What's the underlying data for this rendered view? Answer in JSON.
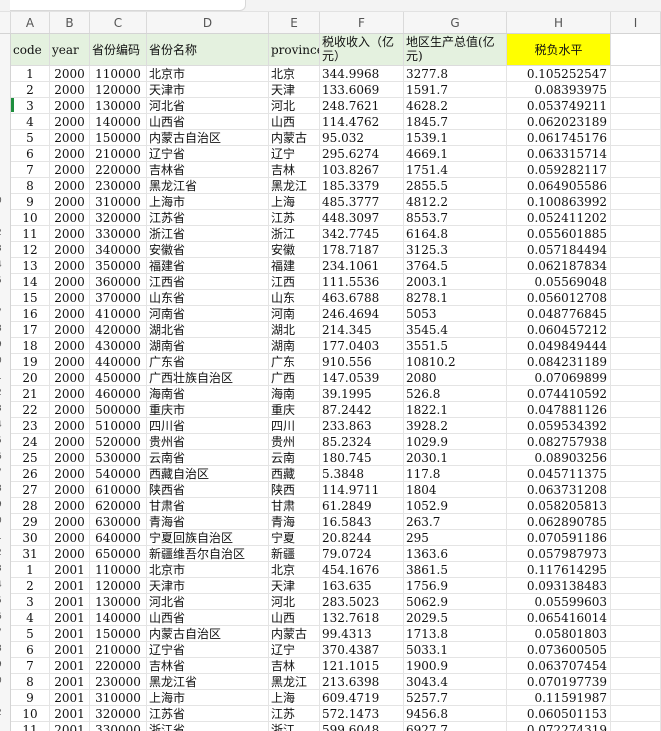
{
  "columns": [
    "A",
    "B",
    "C",
    "D",
    "E",
    "F",
    "G",
    "H",
    "I"
  ],
  "header": [
    "code",
    "year",
    "省份编码",
    "省份名称",
    "province",
    "税收收入（亿元）",
    "地区生产总值(亿元)",
    "税负水平",
    ""
  ],
  "left_row_markers": [
    "",
    "",
    "",
    "",
    "",
    "",
    "",
    "",
    "",
    "0",
    "",
    "2",
    "3",
    "4",
    "5",
    "",
    "7",
    "8",
    "9",
    "0",
    "1",
    "2",
    "3",
    "4",
    "5",
    "6",
    "7",
    "8",
    "9",
    "0",
    "1",
    "2",
    "3",
    "4",
    "5",
    "6",
    "7",
    "8",
    "9",
    "0",
    "",
    "2",
    "",
    ""
  ],
  "rows": [
    [
      "1",
      "2000",
      "110000",
      "北京市",
      "北京",
      "344.9968",
      "3277.8",
      "0.105252547"
    ],
    [
      "2",
      "2000",
      "120000",
      "天津市",
      "天津",
      "133.6069",
      "1591.7",
      "0.08393975"
    ],
    [
      "3",
      "2000",
      "130000",
      "河北省",
      "河北",
      "248.7621",
      "4628.2",
      "0.053749211"
    ],
    [
      "4",
      "2000",
      "140000",
      "山西省",
      "山西",
      "114.4762",
      "1845.7",
      "0.062023189"
    ],
    [
      "5",
      "2000",
      "150000",
      "内蒙古自治区",
      "内蒙古",
      "95.032",
      "1539.1",
      "0.061745176"
    ],
    [
      "6",
      "2000",
      "210000",
      "辽宁省",
      "辽宁",
      "295.6274",
      "4669.1",
      "0.063315714"
    ],
    [
      "7",
      "2000",
      "220000",
      "吉林省",
      "吉林",
      "103.8267",
      "1751.4",
      "0.059282117"
    ],
    [
      "8",
      "2000",
      "230000",
      "黑龙江省",
      "黑龙江",
      "185.3379",
      "2855.5",
      "0.064905586"
    ],
    [
      "9",
      "2000",
      "310000",
      "上海市",
      "上海",
      "485.3777",
      "4812.2",
      "0.100863992"
    ],
    [
      "10",
      "2000",
      "320000",
      "江苏省",
      "江苏",
      "448.3097",
      "8553.7",
      "0.052411202"
    ],
    [
      "11",
      "2000",
      "330000",
      "浙江省",
      "浙江",
      "342.7745",
      "6164.8",
      "0.055601885"
    ],
    [
      "12",
      "2000",
      "340000",
      "安徽省",
      "安徽",
      "178.7187",
      "3125.3",
      "0.057184494"
    ],
    [
      "13",
      "2000",
      "350000",
      "福建省",
      "福建",
      "234.1061",
      "3764.5",
      "0.062187834"
    ],
    [
      "14",
      "2000",
      "360000",
      "江西省",
      "江西",
      "111.5536",
      "2003.1",
      "0.05569048"
    ],
    [
      "15",
      "2000",
      "370000",
      "山东省",
      "山东",
      "463.6788",
      "8278.1",
      "0.056012708"
    ],
    [
      "16",
      "2000",
      "410000",
      "河南省",
      "河南",
      "246.4694",
      "5053",
      "0.048776845"
    ],
    [
      "17",
      "2000",
      "420000",
      "湖北省",
      "湖北",
      "214.345",
      "3545.4",
      "0.060457212"
    ],
    [
      "18",
      "2000",
      "430000",
      "湖南省",
      "湖南",
      "177.0403",
      "3551.5",
      "0.049849444"
    ],
    [
      "19",
      "2000",
      "440000",
      "广东省",
      "广东",
      "910.556",
      "10810.2",
      "0.084231189"
    ],
    [
      "20",
      "2000",
      "450000",
      "广西壮族自治区",
      "广西",
      "147.0539",
      "2080",
      "0.07069899"
    ],
    [
      "21",
      "2000",
      "460000",
      "海南省",
      "海南",
      "39.1995",
      "526.8",
      "0.074410592"
    ],
    [
      "22",
      "2000",
      "500000",
      "重庆市",
      "重庆",
      "87.2442",
      "1822.1",
      "0.047881126"
    ],
    [
      "23",
      "2000",
      "510000",
      "四川省",
      "四川",
      "233.863",
      "3928.2",
      "0.059534392"
    ],
    [
      "24",
      "2000",
      "520000",
      "贵州省",
      "贵州",
      "85.2324",
      "1029.9",
      "0.082757938"
    ],
    [
      "25",
      "2000",
      "530000",
      "云南省",
      "云南",
      "180.745",
      "2030.1",
      "0.08903256"
    ],
    [
      "26",
      "2000",
      "540000",
      "西藏自治区",
      "西藏",
      "5.3848",
      "117.8",
      "0.045711375"
    ],
    [
      "27",
      "2000",
      "610000",
      "陕西省",
      "陕西",
      "114.9711",
      "1804",
      "0.063731208"
    ],
    [
      "28",
      "2000",
      "620000",
      "甘肃省",
      "甘肃",
      "61.2849",
      "1052.9",
      "0.058205813"
    ],
    [
      "29",
      "2000",
      "630000",
      "青海省",
      "青海",
      "16.5843",
      "263.7",
      "0.062890785"
    ],
    [
      "30",
      "2000",
      "640000",
      "宁夏回族自治区",
      "宁夏",
      "20.8244",
      "295",
      "0.070591186"
    ],
    [
      "31",
      "2000",
      "650000",
      "新疆维吾尔自治区",
      "新疆",
      "79.0724",
      "1363.6",
      "0.057987973"
    ],
    [
      "1",
      "2001",
      "110000",
      "北京市",
      "北京",
      "454.1676",
      "3861.5",
      "0.117614295"
    ],
    [
      "2",
      "2001",
      "120000",
      "天津市",
      "天津",
      "163.635",
      "1756.9",
      "0.093138483"
    ],
    [
      "3",
      "2001",
      "130000",
      "河北省",
      "河北",
      "283.5023",
      "5062.9",
      "0.05599603"
    ],
    [
      "4",
      "2001",
      "140000",
      "山西省",
      "山西",
      "132.7618",
      "2029.5",
      "0.065416014"
    ],
    [
      "5",
      "2001",
      "150000",
      "内蒙古自治区",
      "内蒙古",
      "99.4313",
      "1713.8",
      "0.05801803"
    ],
    [
      "6",
      "2001",
      "210000",
      "辽宁省",
      "辽宁",
      "370.4387",
      "5033.1",
      "0.073600505"
    ],
    [
      "7",
      "2001",
      "220000",
      "吉林省",
      "吉林",
      "121.1015",
      "1900.9",
      "0.063707454"
    ],
    [
      "8",
      "2001",
      "230000",
      "黑龙江省",
      "黑龙江",
      "213.6398",
      "3043.4",
      "0.070197739"
    ],
    [
      "9",
      "2001",
      "310000",
      "上海市",
      "上海",
      "609.4719",
      "5257.7",
      "0.11591987"
    ],
    [
      "10",
      "2001",
      "320000",
      "江苏省",
      "江苏",
      "572.1473",
      "9456.8",
      "0.060501153"
    ],
    [
      "11",
      "2001",
      "330000",
      "浙江省",
      "浙江",
      "599.6048",
      "6927.7",
      "0.072274319"
    ]
  ]
}
